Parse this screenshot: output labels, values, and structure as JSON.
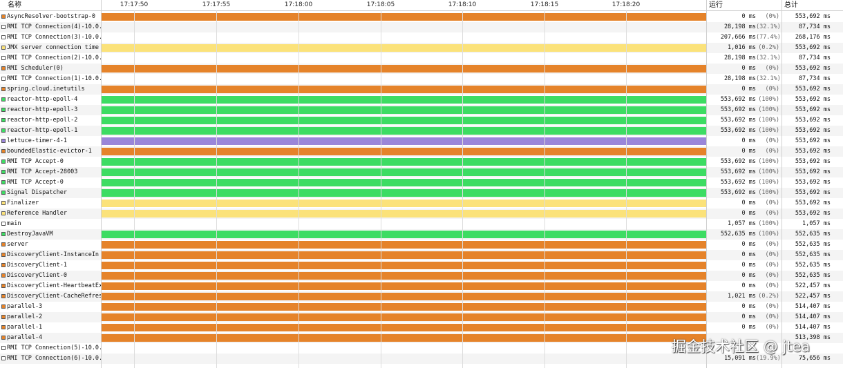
{
  "header": {
    "name_col": "名称",
    "running_col": "运行",
    "total_col": "总计",
    "time_ticks": [
      "17:17:50",
      "17:17:55",
      "17:18:00",
      "17:18:05",
      "17:18:10",
      "17:18:15",
      "17:18:20"
    ]
  },
  "colors": {
    "orange": "#e5832a",
    "white": "#ffffff",
    "yellow": "#fbe27a",
    "green": "#3ddc63",
    "purple": "#9a86d9"
  },
  "threads": [
    {
      "name": "AsyncResolver-bootstrap-0",
      "state": "orange",
      "run_ms": "0 ms",
      "run_pct": "(0%)",
      "total": "553,692 ms"
    },
    {
      "name": "RMI TCP Connection(4)-10.0.",
      "state": "white",
      "run_ms": "28,198 ms",
      "run_pct": "(32.1%)",
      "total": "87,734 ms"
    },
    {
      "name": "RMI TCP Connection(3)-10.0.",
      "state": "white",
      "run_ms": "207,666 ms",
      "run_pct": "(77.4%)",
      "total": "268,176 ms"
    },
    {
      "name": "JMX server connection time",
      "state": "yellow",
      "run_ms": "1,016 ms",
      "run_pct": "(0.2%)",
      "total": "553,692 ms"
    },
    {
      "name": "RMI TCP Connection(2)-10.0.",
      "state": "white",
      "run_ms": "28,198 ms",
      "run_pct": "(32.1%)",
      "total": "87,734 ms"
    },
    {
      "name": "RMI Scheduler(0)",
      "state": "orange",
      "run_ms": "0 ms",
      "run_pct": "(0%)",
      "total": "553,692 ms"
    },
    {
      "name": "RMI TCP Connection(1)-10.0.",
      "state": "white",
      "run_ms": "28,198 ms",
      "run_pct": "(32.1%)",
      "total": "87,734 ms"
    },
    {
      "name": "spring.cloud.inetutils",
      "state": "orange",
      "run_ms": "0 ms",
      "run_pct": "(0%)",
      "total": "553,692 ms"
    },
    {
      "name": "reactor-http-epoll-4",
      "state": "green",
      "run_ms": "553,692 ms",
      "run_pct": "(100%)",
      "total": "553,692 ms"
    },
    {
      "name": "reactor-http-epoll-3",
      "state": "green",
      "run_ms": "553,692 ms",
      "run_pct": "(100%)",
      "total": "553,692 ms"
    },
    {
      "name": "reactor-http-epoll-2",
      "state": "green",
      "run_ms": "553,692 ms",
      "run_pct": "(100%)",
      "total": "553,692 ms"
    },
    {
      "name": "reactor-http-epoll-1",
      "state": "green",
      "run_ms": "553,692 ms",
      "run_pct": "(100%)",
      "total": "553,692 ms"
    },
    {
      "name": "lettuce-timer-4-1",
      "state": "purple",
      "run_ms": "0 ms",
      "run_pct": "(0%)",
      "total": "553,692 ms"
    },
    {
      "name": "boundedElastic-evictor-1",
      "state": "orange",
      "run_ms": "0 ms",
      "run_pct": "(0%)",
      "total": "553,692 ms"
    },
    {
      "name": "RMI TCP Accept-0",
      "state": "green",
      "run_ms": "553,692 ms",
      "run_pct": "(100%)",
      "total": "553,692 ms"
    },
    {
      "name": "RMI TCP Accept-28003",
      "state": "green",
      "run_ms": "553,692 ms",
      "run_pct": "(100%)",
      "total": "553,692 ms"
    },
    {
      "name": "RMI TCP Accept-0",
      "state": "green",
      "run_ms": "553,692 ms",
      "run_pct": "(100%)",
      "total": "553,692 ms"
    },
    {
      "name": "Signal Dispatcher",
      "state": "green",
      "run_ms": "553,692 ms",
      "run_pct": "(100%)",
      "total": "553,692 ms"
    },
    {
      "name": "Finalizer",
      "state": "yellow",
      "run_ms": "0 ms",
      "run_pct": "(0%)",
      "total": "553,692 ms"
    },
    {
      "name": "Reference Handler",
      "state": "yellow",
      "run_ms": "0 ms",
      "run_pct": "(0%)",
      "total": "553,692 ms"
    },
    {
      "name": "main",
      "state": "white",
      "run_ms": "1,057 ms",
      "run_pct": "(100%)",
      "total": "1,057 ms"
    },
    {
      "name": "DestroyJavaVM",
      "state": "green",
      "run_ms": "552,635 ms",
      "run_pct": "(100%)",
      "total": "552,635 ms"
    },
    {
      "name": "server",
      "state": "orange",
      "run_ms": "0 ms",
      "run_pct": "(0%)",
      "total": "552,635 ms"
    },
    {
      "name": "DiscoveryClient-InstanceIn",
      "state": "orange",
      "run_ms": "0 ms",
      "run_pct": "(0%)",
      "total": "552,635 ms"
    },
    {
      "name": "DiscoveryClient-1",
      "state": "orange",
      "run_ms": "0 ms",
      "run_pct": "(0%)",
      "total": "552,635 ms"
    },
    {
      "name": "DiscoveryClient-0",
      "state": "orange",
      "run_ms": "0 ms",
      "run_pct": "(0%)",
      "total": "552,635 ms"
    },
    {
      "name": "DiscoveryClient-HeartbeatEx",
      "state": "orange",
      "run_ms": "0 ms",
      "run_pct": "(0%)",
      "total": "522,457 ms"
    },
    {
      "name": "DiscoveryClient-CacheRefres",
      "state": "orange",
      "run_ms": "1,021 ms",
      "run_pct": "(0.2%)",
      "total": "522,457 ms"
    },
    {
      "name": "parallel-3",
      "state": "orange",
      "run_ms": "0 ms",
      "run_pct": "(0%)",
      "total": "514,407 ms"
    },
    {
      "name": "parallel-2",
      "state": "orange",
      "run_ms": "0 ms",
      "run_pct": "(0%)",
      "total": "514,407 ms"
    },
    {
      "name": "parallel-1",
      "state": "orange",
      "run_ms": "0 ms",
      "run_pct": "(0%)",
      "total": "514,407 ms"
    },
    {
      "name": "parallel-4",
      "state": "orange",
      "run_ms": "",
      "run_pct": "",
      "total": "513,398 ms"
    },
    {
      "name": "RMI TCP Connection(5)-10.0.",
      "state": "white",
      "run_ms": "",
      "run_pct": "",
      "total": ""
    },
    {
      "name": "RMI TCP Connection(6)-10.0.",
      "state": "white",
      "run_ms": "15,091 ms",
      "run_pct": "(19.9%)",
      "total": "75,656 ms"
    }
  ],
  "watermark": "掘金技术社区 @ jtea"
}
